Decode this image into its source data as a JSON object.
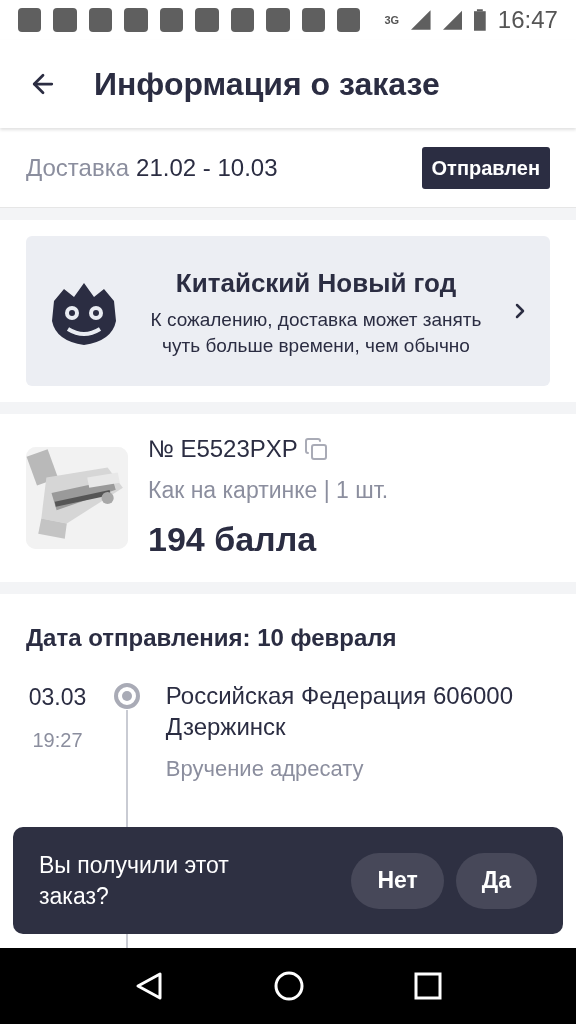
{
  "status_bar": {
    "network": "3G",
    "time": "16:47"
  },
  "header": {
    "title": "Информация о заказе"
  },
  "delivery": {
    "label": "Доставка",
    "dates": "21.02 - 10.03",
    "status": "Отправлен"
  },
  "notice": {
    "title": "Китайский Новый год",
    "text": "К сожалению, доставка может занять чуть больше времени, чем обычно"
  },
  "product": {
    "number": "№ E5523PXP",
    "variant": "Как на картинке | 1 шт.",
    "price": "194 балла"
  },
  "tracking": {
    "heading": "Дата отправления: 10 февраля",
    "events": [
      {
        "date": "03.03",
        "time": "19:27",
        "place": "Российская Федерация 606000 Дзержинск",
        "status": "Вручение адресату"
      }
    ]
  },
  "snackbar": {
    "question": "Вы получили этот заказ?",
    "buttons": [
      "Нет",
      "Да"
    ]
  }
}
